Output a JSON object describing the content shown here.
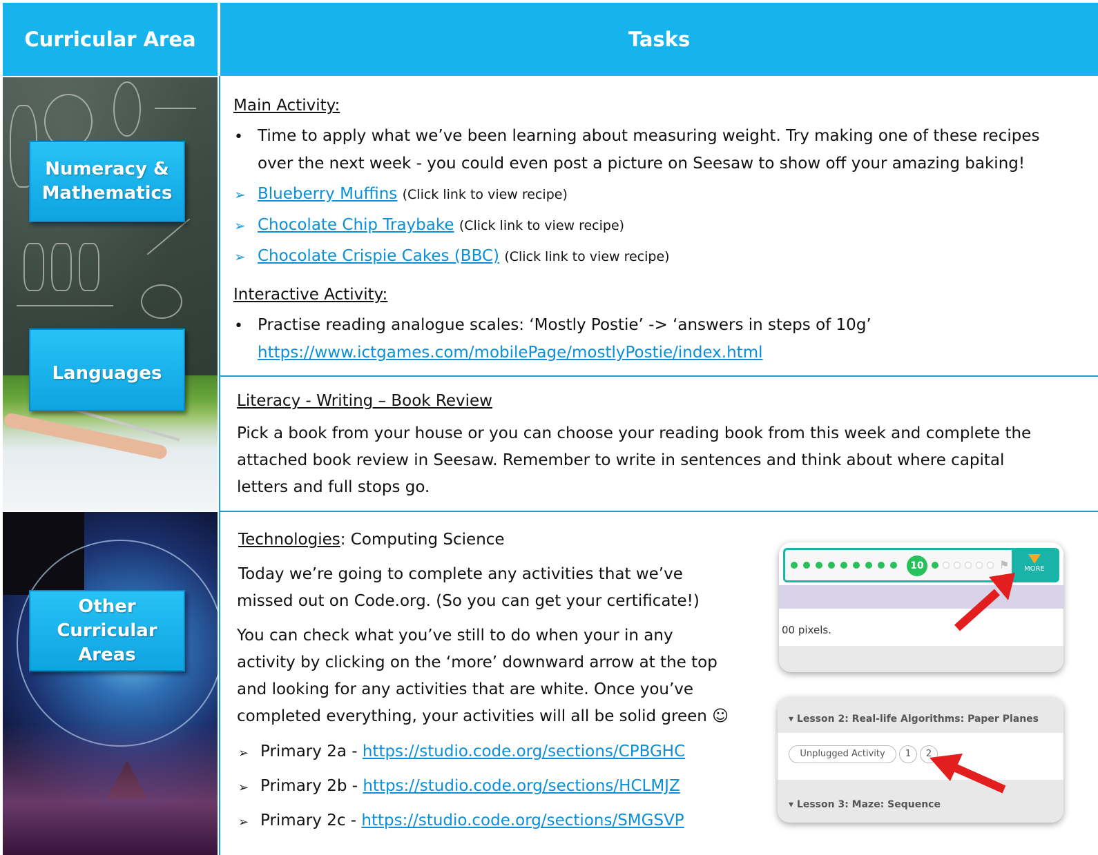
{
  "header": {
    "left_title": "Curricular Area",
    "right_title": "Tasks"
  },
  "areas": {
    "numeracy": "Numeracy & Mathematics",
    "languages": "Languages",
    "other": "Other Curricular Areas"
  },
  "numeracy_tasks": {
    "main_heading": "Main Activity:",
    "main_text_line1": "Time to apply what we’ve been learning about measuring weight. Try making one of these recipes",
    "main_text_line2": "over the next week - you could even post a picture on Seesaw to show off your amazing baking!",
    "recipes": [
      {
        "label": "Blueberry Muffins",
        "note": "(Click link to view recipe)"
      },
      {
        "label": "Chocolate Chip Traybake",
        "note": "(Click link to view recipe)"
      },
      {
        "label": "Chocolate Crispie Cakes (BBC)",
        "note": "(Click link to view recipe)"
      }
    ],
    "interactive_heading": "Interactive Activity:",
    "interactive_text": "Practise reading analogue scales: ‘Mostly Postie’ -> ‘answers in steps of 10g’",
    "interactive_link": "https://www.ictgames.com/mobilePage/mostlyPostie/index.html"
  },
  "literacy_tasks": {
    "heading": "Literacy - Writing – Book Review",
    "line1": "Pick a book from your house or you can choose your reading book from this week and complete the",
    "line2": "attached book review in Seesaw. Remember to write in sentences and think about where capital",
    "line3": "letters and full stops go."
  },
  "other_tasks": {
    "heading_underlined": "Technologies",
    "heading_rest": ": Computing Science",
    "p1_line1": "Today we’re going to complete any activities that we’ve",
    "p1_line2": "missed out on Code.org. (So you can get your certificate!)",
    "p2_line1": "You can check what you’ve still to do when your in any",
    "p2_line2": "activity by clicking on the ‘more’ downward arrow at the top",
    "p2_line3": "and looking for any activities that are white. Once you’ve",
    "p2_line4": "completed everything, your activities will all be solid green ☺",
    "classes": [
      {
        "label": "Primary 2a - ",
        "link": "https://studio.code.org/sections/CPBGHC"
      },
      {
        "label": "Primary 2b - ",
        "link": "https://studio.code.org/sections/HCLMJZ"
      },
      {
        "label": "Primary 2c - ",
        "link": "https://studio.code.org/sections/SMGSVP"
      }
    ]
  },
  "screenshot1": {
    "current_level": "10",
    "more_label": "MORE",
    "text": "00 pixels.",
    "green_dots_before": 9,
    "green_dots_after": 1,
    "white_dots": 5
  },
  "screenshot2": {
    "lesson2": "Lesson 2: Real-life Algorithms: Paper Planes",
    "unplugged": "Unplugged Activity",
    "level1": "1",
    "level2": "2",
    "lesson3": "Lesson 3: Maze: Sequence"
  },
  "colors": {
    "header_bg": "#16b3ec",
    "link": "#0a8fd8",
    "badge": "#0fa3e2",
    "code_green": "#27c05a",
    "arrow_red": "#e21e1e"
  }
}
